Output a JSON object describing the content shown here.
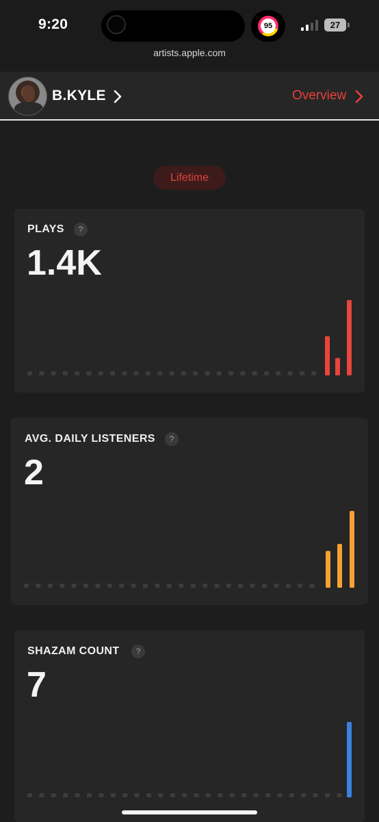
{
  "status_bar": {
    "time": "9:20",
    "fitness_value": "95",
    "battery": "27",
    "url": "artists.apple.com"
  },
  "header": {
    "artist_name": "B.KYLE",
    "overview_label": "Overview",
    "accent_color": "#e8413a"
  },
  "filter": {
    "period_label": "Lifetime"
  },
  "cards": [
    {
      "title": "PLAYS",
      "help": "?",
      "value": "1.4K",
      "color": "#e8453c",
      "bar_values": [
        0.52,
        0.23,
        1.0
      ]
    },
    {
      "title": "AVG. DAILY LISTENERS",
      "help": "?",
      "value": "2",
      "color": "#f5a235",
      "bar_values": [
        0.48,
        0.57,
        1.0
      ]
    },
    {
      "title": "SHAZAM COUNT",
      "help": "?",
      "value": "7",
      "color": "#3b82e0",
      "bar_values": [
        1.0
      ]
    }
  ]
}
